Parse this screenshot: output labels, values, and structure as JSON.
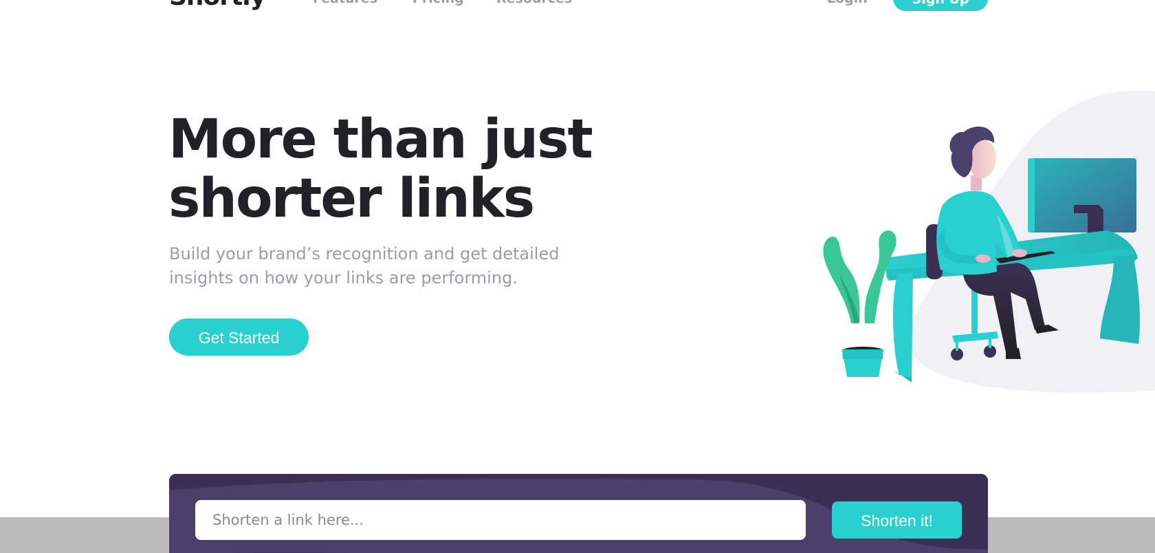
{
  "nav": {
    "logo": "Shortly",
    "links": [
      "Features",
      "Pricing",
      "Resources"
    ],
    "login": "Login",
    "signup": "Sign Up"
  },
  "hero": {
    "title_line1": "More than just",
    "title_line2": "shorter links",
    "subtitle_line1": "Build your brand’s recognition and get detailed",
    "subtitle_line2": "insights on how your links are performing.",
    "cta": "Get Started"
  },
  "shorten": {
    "placeholder": "Shorten a link here...",
    "button": "Shorten it!"
  },
  "icons": {
    "illustration": "person-working-at-desk-illustration"
  },
  "colors": {
    "primary": "#2acfcf",
    "dark_violet": "#3b3054",
    "panel": "#4b3f6b",
    "heading": "#232127",
    "gray": "#9e9aa7",
    "blob": "#eff1f7"
  }
}
